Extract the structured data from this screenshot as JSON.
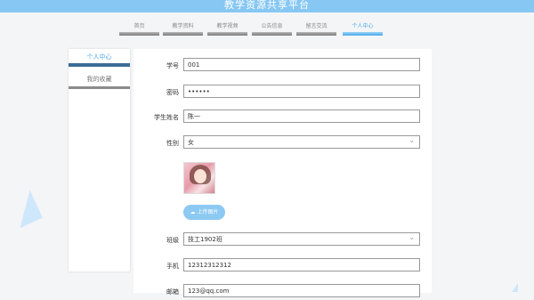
{
  "header": {
    "title": "教学资源共享平台"
  },
  "nav": {
    "items": [
      {
        "label": "首页"
      },
      {
        "label": "教学资料"
      },
      {
        "label": "教学视频"
      },
      {
        "label": "公告信息"
      },
      {
        "label": "留言交流"
      },
      {
        "label": "个人中心"
      }
    ],
    "active_index": 5
  },
  "sidebar": {
    "items": [
      {
        "label": "个人中心"
      },
      {
        "label": "我的收藏"
      }
    ]
  },
  "form": {
    "student_id": {
      "label": "学号",
      "value": "001"
    },
    "password": {
      "label": "密码",
      "value": "••••••"
    },
    "name": {
      "label": "学生姓名",
      "value": "陈一"
    },
    "gender": {
      "label": "性别",
      "value": "女"
    },
    "upload_label": "上传图片",
    "class": {
      "label": "班级",
      "value": "技工1902班"
    },
    "phone": {
      "label": "手机",
      "value": "12312312312"
    },
    "email": {
      "label": "邮箱",
      "value": "123@qq.com"
    }
  },
  "colors": {
    "accent": "#4aa8e8",
    "header": "#86c7f3"
  }
}
